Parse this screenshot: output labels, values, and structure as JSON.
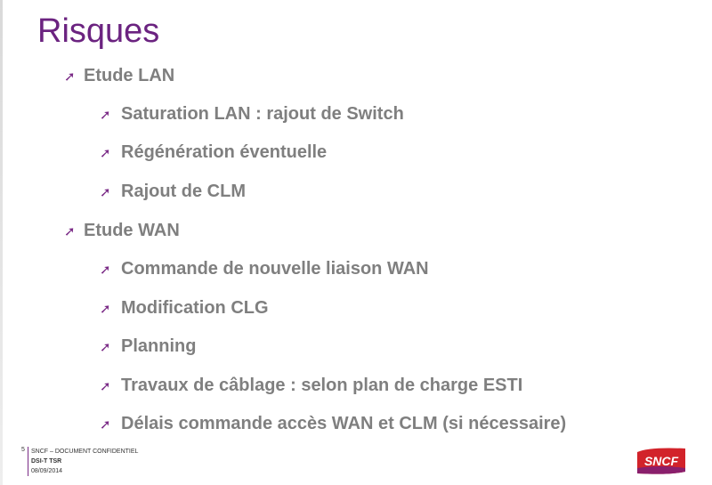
{
  "slide": {
    "title": "Risques",
    "bullets": [
      {
        "level": 1,
        "text": "Etude LAN"
      },
      {
        "level": 2,
        "text": "Saturation LAN : rajout  de Switch"
      },
      {
        "level": 2,
        "text": "Régénération éventuelle"
      },
      {
        "level": 2,
        "text": "Rajout de CLM"
      },
      {
        "level": 1,
        "text": "Etude WAN"
      },
      {
        "level": 2,
        "text": "Commande de nouvelle liaison WAN"
      },
      {
        "level": 2,
        "text": "Modification CLG"
      },
      {
        "level": 2,
        "text": "Planning"
      },
      {
        "level": 2,
        "text": "Travaux de câblage : selon plan de charge ESTI"
      },
      {
        "level": 2,
        "text": "Délais commande accès WAN et CLM (si nécessaire)"
      }
    ],
    "bullet_icon": "arrow-up-right-icon",
    "bullet_glyph": "➚"
  },
  "footer": {
    "page_number": "5",
    "line1": "SNCF – DOCUMENT CONFIDENTIEL",
    "line2": "DSI-T TSR",
    "line3": "08/09/2014"
  },
  "logo": {
    "text": "SNCF",
    "colors": {
      "primary": "#d2232a",
      "secondary": "#8a1f6c"
    }
  },
  "colors": {
    "title": "#6b2380",
    "bullet_text": "#7f7f7f",
    "arrow": "#7a2a86"
  }
}
